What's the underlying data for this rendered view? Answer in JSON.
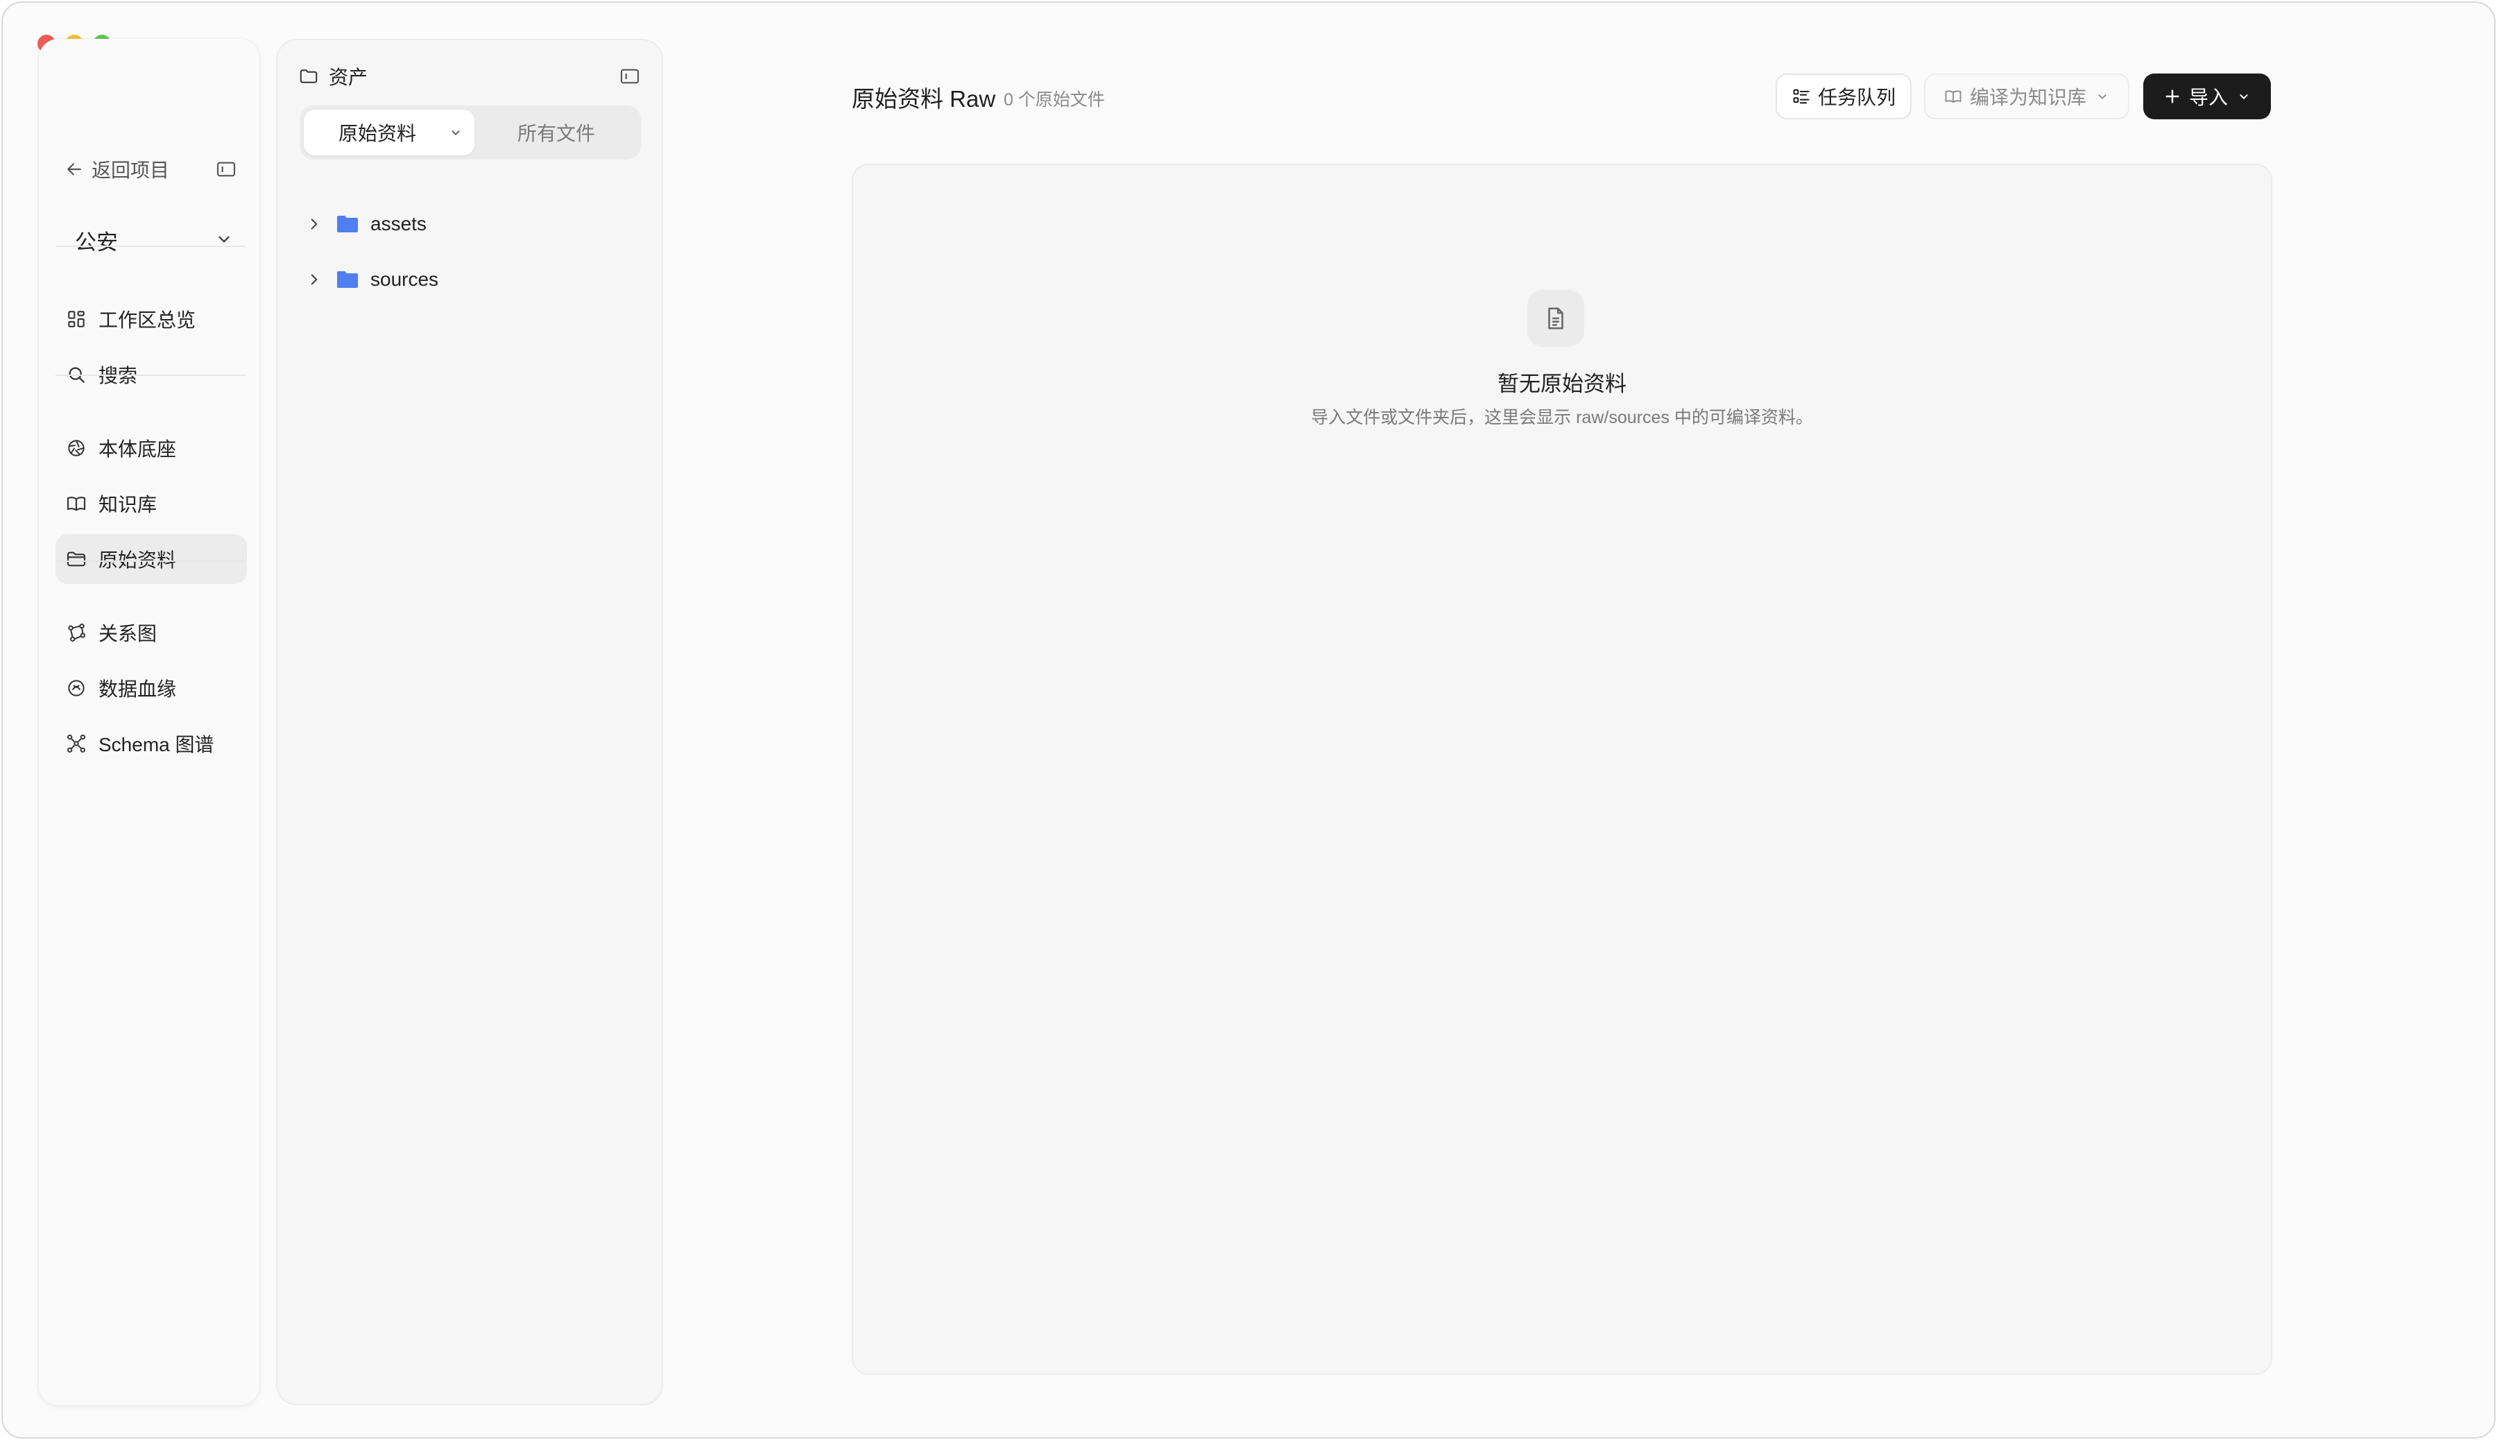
{
  "sidebar": {
    "back_label": "返回项目",
    "project": "公安",
    "items": [
      {
        "label": "工作区总览",
        "icon": "dashboard-icon"
      },
      {
        "label": "搜索",
        "icon": "search-icon"
      },
      {
        "label": "本体底座",
        "icon": "aperture-icon"
      },
      {
        "label": "知识库",
        "icon": "book-icon"
      },
      {
        "label": "原始资料",
        "icon": "folder-icon",
        "active": true
      },
      {
        "label": "关系图",
        "icon": "graph-icon"
      },
      {
        "label": "数据血缘",
        "icon": "lineage-icon"
      },
      {
        "label": "Schema 图谱",
        "icon": "schema-icon"
      }
    ]
  },
  "assets": {
    "title": "资产",
    "tabs": {
      "raw": "原始资料",
      "all": "所有文件"
    },
    "tree": [
      {
        "name": "assets"
      },
      {
        "name": "sources"
      }
    ]
  },
  "main": {
    "title": "原始资料 Raw",
    "count": "0 个原始文件",
    "buttons": {
      "queue": "任务队列",
      "compile": "编译为知识库",
      "import": "导入"
    },
    "empty": {
      "title": "暂无原始资料",
      "description": "导入文件或文件夹后，这里会显示 raw/sources 中的可编译资料。"
    }
  },
  "colors": {
    "folder": "#4f7ff0",
    "primary_button": "#1c1c1c",
    "active_nav": "#ececec"
  }
}
